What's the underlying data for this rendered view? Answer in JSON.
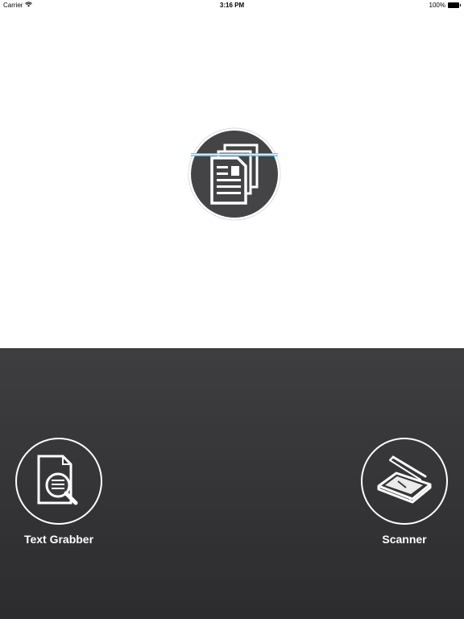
{
  "status_bar": {
    "carrier": "Carrier",
    "time": "3:16 PM",
    "battery_percent_label": "100%",
    "battery_level": 1.0,
    "wifi_icon": "wifi-icon",
    "battery_icon": "battery-icon"
  },
  "hero": {
    "icon": "document-scan-icon"
  },
  "actions": [
    {
      "label": "Text Grabber",
      "icon": "document-search-icon"
    },
    {
      "label": "Scanner",
      "icon": "flatbed-scanner-icon"
    }
  ],
  "colors": {
    "panel_top": "#3e3e40",
    "panel_bottom": "#2c2c2e",
    "hero_circle": "#444446",
    "scan_line": "#5ab8ff",
    "icon_white": "#ffffff"
  }
}
